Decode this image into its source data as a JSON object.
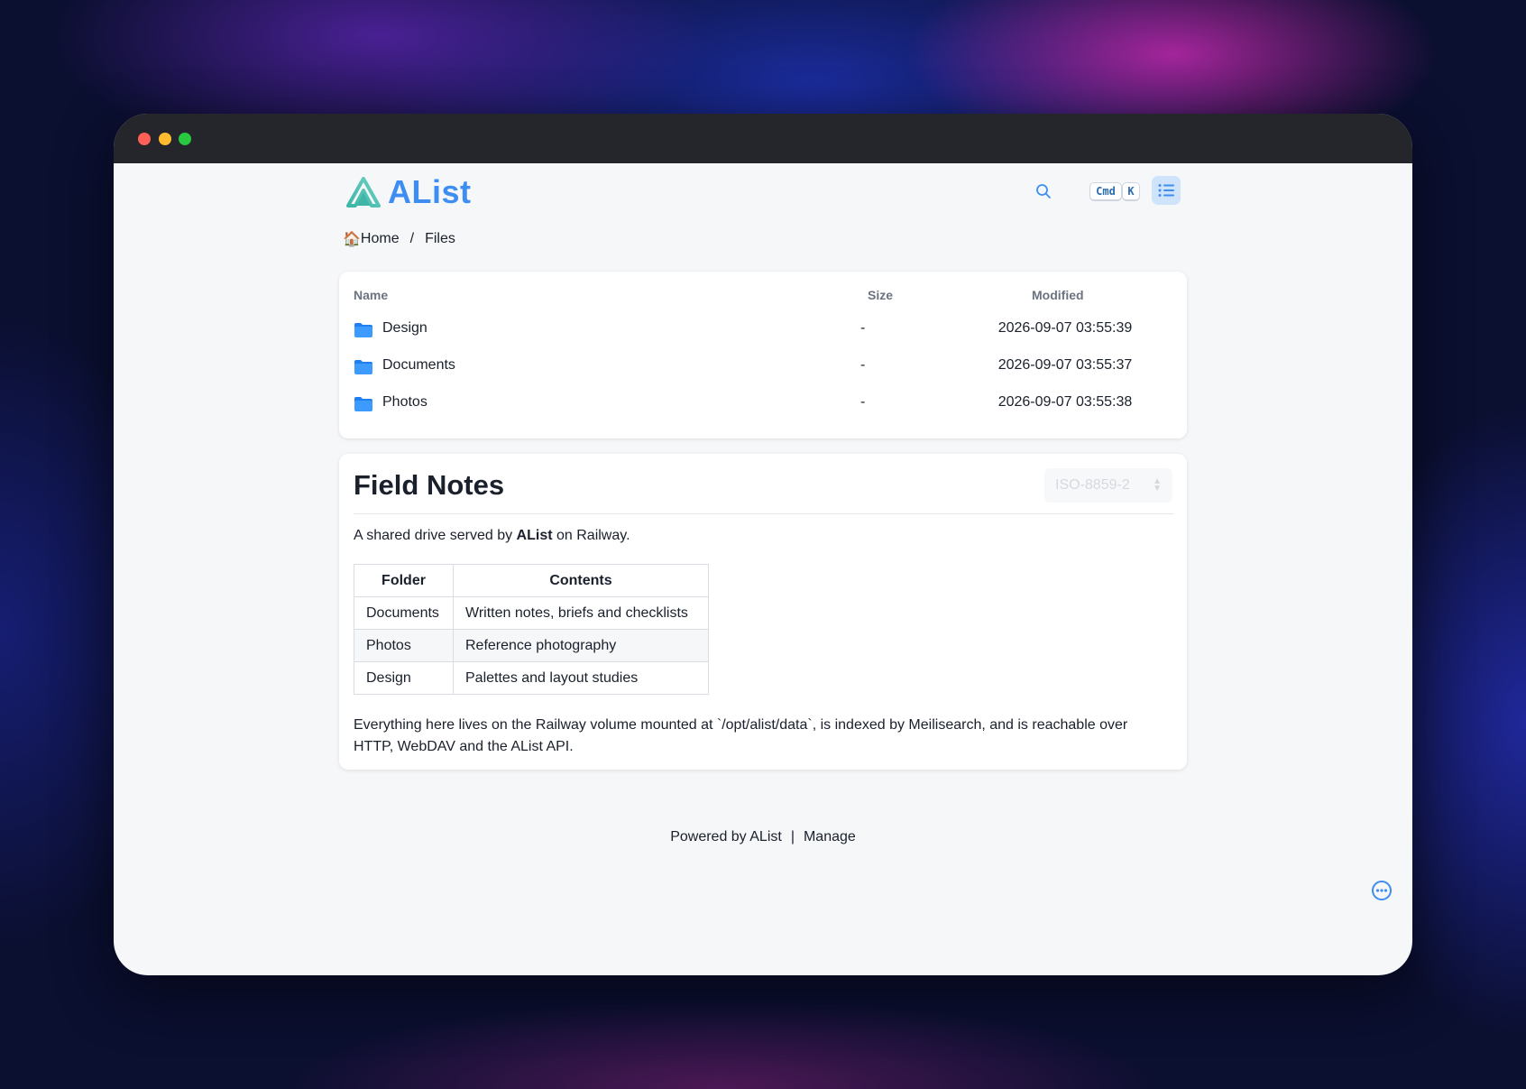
{
  "app": {
    "name": "AList",
    "accent_color": "#3e8ef2"
  },
  "header": {
    "logo_text": "AList",
    "shortcut_keys": [
      "Cmd",
      "K"
    ],
    "search_icon": "search-icon",
    "layout_icon": "list-icon"
  },
  "breadcrumb": {
    "home_icon": "🏠",
    "items": [
      "Home",
      "Files"
    ],
    "separator": "/"
  },
  "file_list": {
    "columns": {
      "name": "Name",
      "size": "Size",
      "modified": "Modified"
    },
    "rows": [
      {
        "name": "Design",
        "size": "-",
        "modified": "2026-09-07 03:55:39",
        "icon": "folder-icon"
      },
      {
        "name": "Documents",
        "size": "-",
        "modified": "2026-09-07 03:55:37",
        "icon": "folder-icon"
      },
      {
        "name": "Photos",
        "size": "-",
        "modified": "2026-09-07 03:55:38",
        "icon": "folder-icon"
      }
    ]
  },
  "readme": {
    "title": "Field Notes",
    "encoding": "ISO-8859-2",
    "intro_before": "A shared drive served by ",
    "intro_bold": "AList",
    "intro_after": " on Railway.",
    "table": {
      "headers": [
        "Folder",
        "Contents"
      ],
      "rows": [
        [
          "Documents",
          "Written notes, briefs and checklists"
        ],
        [
          "Photos",
          "Reference photography"
        ],
        [
          "Design",
          "Palettes and layout studies"
        ]
      ]
    },
    "outro": "Everything here lives on the Railway volume mounted at `/opt/alist/data`, is indexed by Meilisearch, and is reachable over HTTP, WebDAV and the AList API."
  },
  "footer": {
    "powered_by": "Powered by AList",
    "separator": "|",
    "manage": "Manage"
  },
  "floating": {
    "more_icon": "more-icon"
  }
}
